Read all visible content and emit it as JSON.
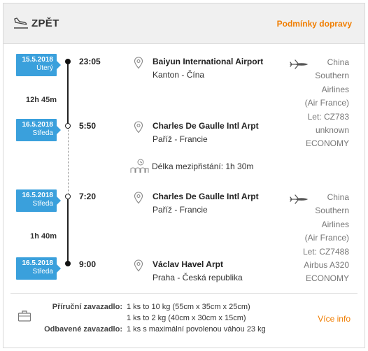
{
  "header": {
    "title": "ZPĚT",
    "conditions_link": "Podmínky dopravy"
  },
  "segments": [
    {
      "departure": {
        "date": "15.5.2018",
        "weekday": "Úterý",
        "time": "23:05",
        "airport": "Baiyun International Airport",
        "city": "Kanton - Čína"
      },
      "duration": "12h 45m",
      "arrival": {
        "date": "16.5.2018",
        "weekday": "Středa",
        "time": "5:50",
        "airport": "Charles De Gaulle Intl Arpt",
        "city": "Paříž - Francie"
      },
      "carrier_lines": [
        "China",
        "Southern",
        "Airlines",
        "(Air France)",
        "Let: CZ783",
        "unknown",
        "ECONOMY"
      ]
    },
    {
      "departure": {
        "date": "16.5.2018",
        "weekday": "Středa",
        "time": "7:20",
        "airport": "Charles De Gaulle Intl Arpt",
        "city": "Paříž - Francie"
      },
      "duration": "1h 40m",
      "arrival": {
        "date": "16.5.2018",
        "weekday": "Středa",
        "time": "9:00",
        "airport": "Václav Havel Arpt",
        "city": "Praha - Česká republika"
      },
      "carrier_lines": [
        "China",
        "Southern",
        "Airlines",
        "(Air France)",
        "Let: CZ7488",
        "Airbus A320",
        "ECONOMY"
      ]
    }
  ],
  "layover": "Délka mezipřistání: 1h 30m",
  "baggage": {
    "cabin_label": "Příruční zavazadlo:",
    "cabin_lines": [
      "1 ks to 10 kg (55cm x 35cm x 25cm)",
      "1 ks to 2 kg (40cm x 30cm x 15cm)"
    ],
    "checked_label": "Odbavené zavazadlo:",
    "checked_value": "1 ks s maximální povolenou váhou 23 kg",
    "more_link": "Více info"
  },
  "colors": {
    "accent": "#f07d00",
    "date_badge": "#3aa0dc",
    "header_bg": "#f0f0f0"
  },
  "icons": {
    "header": "plane-landing-icon",
    "location": "map-pin-icon",
    "airline": "airplane-icon",
    "layover": "waiting-room-icon",
    "baggage": "suitcase-icon"
  }
}
